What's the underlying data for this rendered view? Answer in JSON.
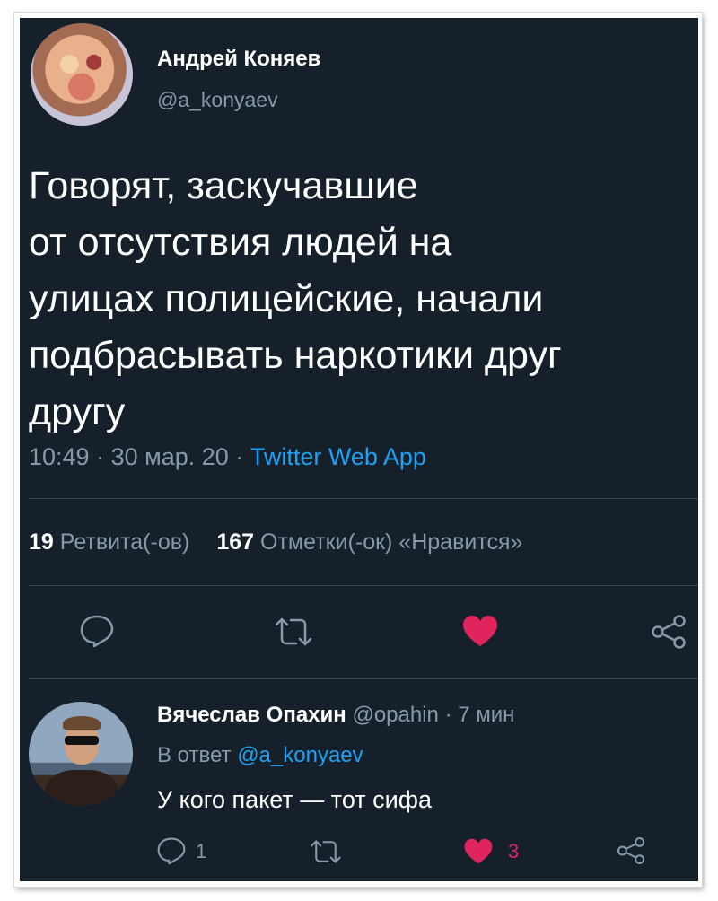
{
  "tweet": {
    "author_name": "Андрей Коняев",
    "author_handle": "@a_konyaev",
    "text_lines": [
      "Говорят, заскучавшие",
      "от отсутствия людей на",
      "улицах полицейские, начали",
      "подбрасывать наркотики друг",
      "другу"
    ],
    "time": "10:49",
    "date": "30 мар. 20",
    "separator": "·",
    "source": "Twitter Web App",
    "retweets_count": "19",
    "retweets_label": "Ретвита(-ов)",
    "likes_count": "167",
    "likes_label": "Отметки(-ок) «Нравится»"
  },
  "reply": {
    "author_name": "Вячеслав Опахин",
    "author_handle": "@opahin",
    "separator": "·",
    "time_ago": "7 мин",
    "in_reply_prefix": "В ответ",
    "in_reply_mention": "@a_konyaev",
    "text": "У кого пакет — тот сифа",
    "reply_count": "1",
    "like_count": "3"
  },
  "icons": {
    "reply": "comment-icon",
    "retweet": "retweet-icon",
    "like": "heart-filled-icon",
    "share": "share-icon"
  },
  "colors": {
    "background": "#15202b",
    "accent": "#1da1f2",
    "like": "#e0245e",
    "secondary_text": "#8899a6"
  }
}
